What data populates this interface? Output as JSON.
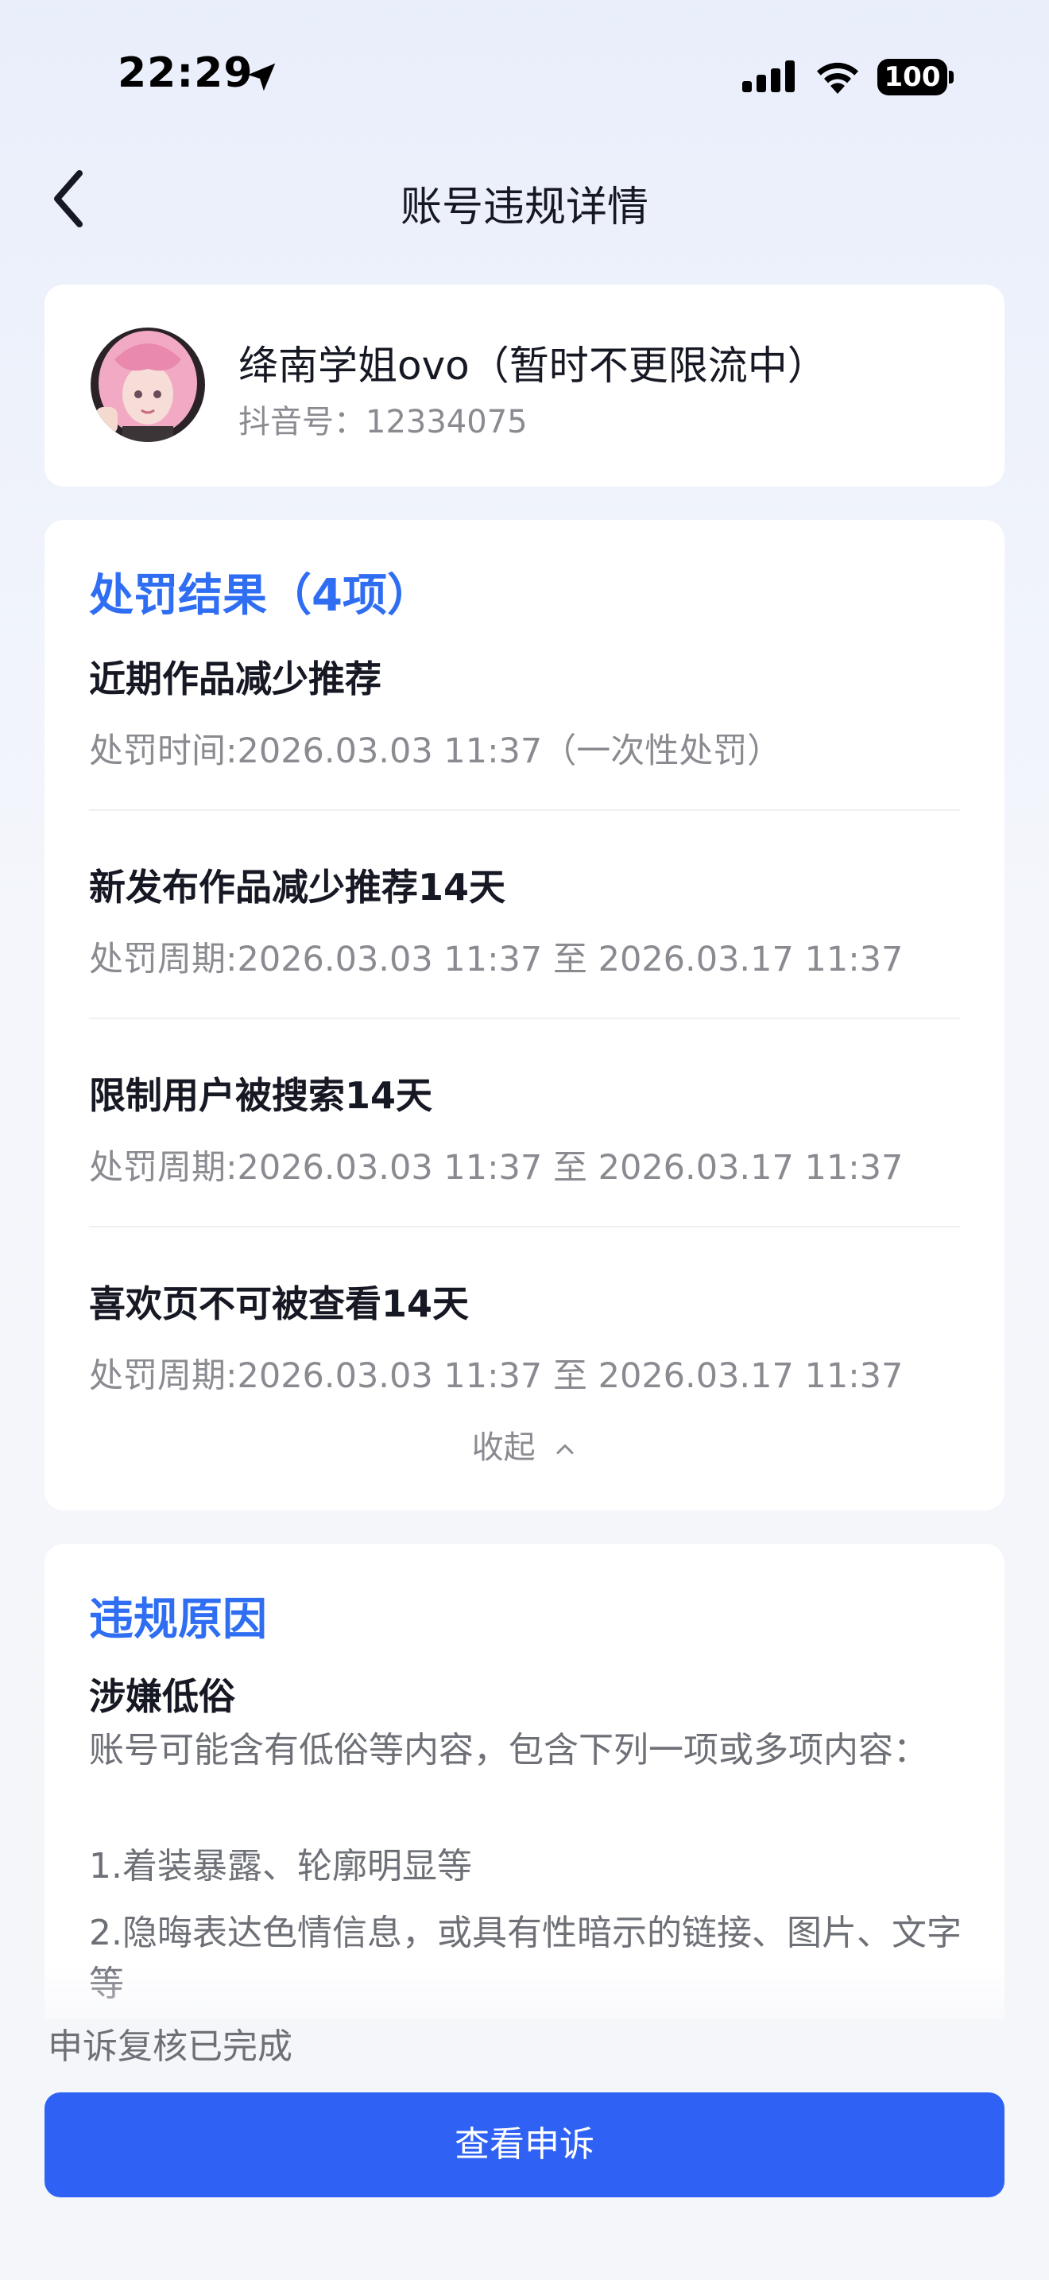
{
  "status_bar": {
    "time": "22:29",
    "battery": "100",
    "icons": [
      "location-arrow-icon",
      "cellular-signal-icon",
      "wifi-icon",
      "battery-icon"
    ]
  },
  "nav": {
    "title": "账号违规详情",
    "back_icon": "chevron-left-icon"
  },
  "user": {
    "name": "绛南学姐ovo（暂时不更限流中）",
    "id_label": "抖音号：12334075"
  },
  "penalty": {
    "title": "处罚结果（4项）",
    "items": [
      {
        "name": "近期作品减少推荐",
        "time": "处罚时间:2026.03.03 11:37（一次性处罚）"
      },
      {
        "name": "新发布作品减少推荐14天",
        "time": "处罚周期:2026.03.03 11:37 至 2026.03.17 11:37"
      },
      {
        "name": "限制用户被搜索14天",
        "time": "处罚周期:2026.03.03 11:37 至 2026.03.17 11:37"
      },
      {
        "name": "喜欢页不可被查看14天",
        "time": "处罚周期:2026.03.03 11:37 至 2026.03.17 11:37"
      }
    ],
    "collapse_label": "收起"
  },
  "reason": {
    "title": "违规原因",
    "name": "涉嫌低俗",
    "description": "账号可能含有低俗等内容，包含下列一项或多项内容：",
    "points": [
      "1.着装暴露、轮廓明显等",
      "2.隐晦表达色情信息，或具有性暗示的链接、图片、文字等"
    ]
  },
  "appeal": {
    "status": "申诉复核已完成",
    "button_label": "查看申诉"
  },
  "colors": {
    "accent": "#2f6ef2",
    "button": "#2f62f4",
    "primary_text": "#161823",
    "secondary_text": "#8a8b91"
  }
}
